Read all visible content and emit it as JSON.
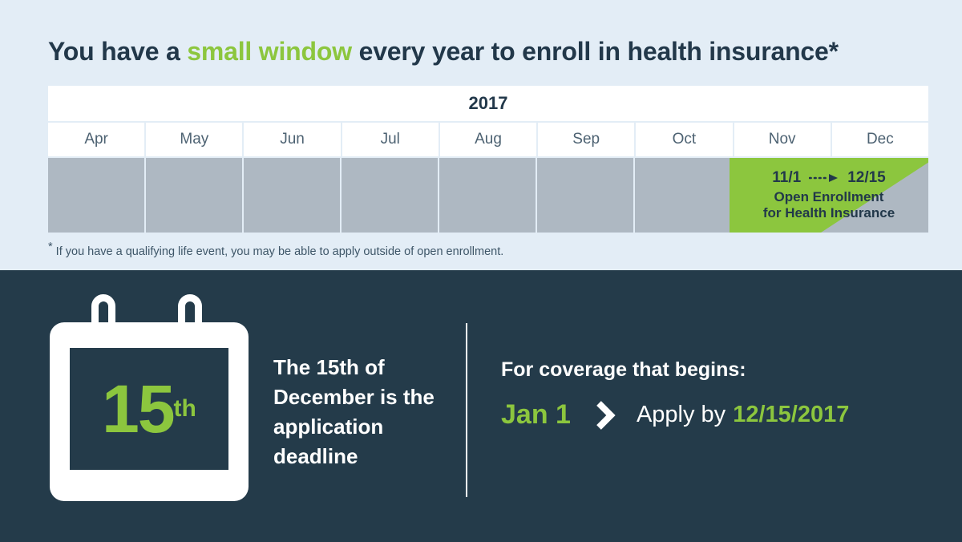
{
  "colors": {
    "background": "#e3edf6",
    "dark_panel": "#243b4a",
    "accent_green": "#8cc63e",
    "bar_gray": "#aeb8c2",
    "white": "#ffffff"
  },
  "headline": {
    "before": "You have a ",
    "accent": "small window",
    "after": " every year to enroll in health insurance*"
  },
  "calendar": {
    "year": "2017",
    "months": [
      "Apr",
      "May",
      "Jun",
      "Jul",
      "Aug",
      "Sep",
      "Oct",
      "Nov",
      "Dec"
    ],
    "enrollment": {
      "start_date": "11/1",
      "end_date": "12/15",
      "label_line1": "Open Enrollment",
      "label_line2": "for Health Insurance"
    }
  },
  "footnote": {
    "marker": "*",
    "text": " If you have a qualifying life event, you may be able to apply outside of open enrollment."
  },
  "bottom": {
    "icon": {
      "day": "15",
      "suffix": "th"
    },
    "deadline_text": "The 15th of December is the application deadline",
    "coverage": {
      "title": "For coverage that begins:",
      "start": "Jan 1",
      "apply_label": "Apply by",
      "deadline": "12/15/2017"
    }
  }
}
